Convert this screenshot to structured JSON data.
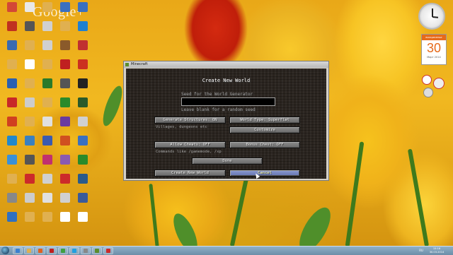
{
  "desktop": {
    "watermark_logo": "Google+",
    "icons_col1": [
      {
        "label": "",
        "icon": "chrome-icon",
        "color": "#d34836"
      },
      {
        "label": "",
        "icon": "app-icon",
        "color": "#c03020"
      },
      {
        "label": "",
        "icon": "app-icon",
        "color": "#3a6ab0"
      },
      {
        "label": "",
        "icon": "folder-icon",
        "color": "#e0b050"
      },
      {
        "label": "",
        "icon": "app-icon",
        "color": "#2a5fb0"
      },
      {
        "label": "",
        "icon": "app-icon",
        "color": "#c82828"
      },
      {
        "label": "",
        "icon": "app-icon",
        "color": "#d04020"
      },
      {
        "label": "",
        "icon": "app-icon",
        "color": "#2288cc"
      },
      {
        "label": "",
        "icon": "app-icon",
        "color": "#3a90d8"
      },
      {
        "label": "",
        "icon": "app-icon",
        "color": "#e0b050"
      },
      {
        "label": "",
        "icon": "app-icon",
        "color": "#888888"
      },
      {
        "label": "",
        "icon": "app-icon",
        "color": "#3070c0"
      }
    ],
    "icons_col2": [
      {
        "label": "",
        "icon": "app-icon",
        "color": "#e8e8e8"
      },
      {
        "label": "",
        "icon": "app-icon",
        "color": "#555555"
      },
      {
        "label": "",
        "icon": "folder-icon",
        "color": "#e0b050"
      },
      {
        "label": "",
        "icon": "app-icon",
        "color": "#ffffff"
      },
      {
        "label": "",
        "icon": "app-icon",
        "color": "#e0b050"
      },
      {
        "label": "",
        "icon": "app-icon",
        "color": "#cccccc"
      },
      {
        "label": "",
        "icon": "app-icon",
        "color": "#e0b050"
      },
      {
        "label": "",
        "icon": "app-icon",
        "color": "#3a80c0"
      },
      {
        "label": "",
        "icon": "app-icon",
        "color": "#555555"
      },
      {
        "label": "",
        "icon": "app-icon",
        "color": "#cc2a2a"
      },
      {
        "label": "",
        "icon": "app-icon",
        "color": "#cccccc"
      },
      {
        "label": "",
        "icon": "app-icon",
        "color": "#e0b050"
      }
    ],
    "icons_col3": [
      {
        "label": "",
        "icon": "folder-icon",
        "color": "#e0b050"
      },
      {
        "label": "",
        "icon": "app-icon",
        "color": "#d0d0d0"
      },
      {
        "label": "",
        "icon": "app-icon",
        "color": "#d0d0d0"
      },
      {
        "label": "",
        "icon": "app-icon",
        "color": "#e0b050"
      },
      {
        "label": "",
        "icon": "app-icon",
        "color": "#2a7a2a"
      },
      {
        "label": "",
        "icon": "app-icon",
        "color": "#e0b050"
      },
      {
        "label": "",
        "icon": "app-icon",
        "color": "#e0e0e0"
      },
      {
        "label": "",
        "icon": "app-icon",
        "color": "#3a5ab0"
      },
      {
        "label": "",
        "icon": "app-icon",
        "color": "#c03070"
      },
      {
        "label": "",
        "icon": "app-icon",
        "color": "#d0d0d0"
      },
      {
        "label": "",
        "icon": "app-icon",
        "color": "#e0e0e0"
      },
      {
        "label": "",
        "icon": "app-icon",
        "color": "#e0b050"
      }
    ],
    "icons_col4": [
      {
        "label": "",
        "icon": "app-icon",
        "color": "#3a70c0"
      },
      {
        "label": "",
        "icon": "folder-icon",
        "color": "#e0b050"
      },
      {
        "label": "",
        "icon": "app-icon",
        "color": "#8a5a2a"
      },
      {
        "label": "",
        "icon": "app-icon",
        "color": "#c02020"
      },
      {
        "label": "",
        "icon": "app-icon",
        "color": "#555555"
      },
      {
        "label": "",
        "icon": "app-icon",
        "color": "#2a8a2a"
      },
      {
        "label": "",
        "icon": "app-icon",
        "color": "#6a3aa0"
      },
      {
        "label": "",
        "icon": "app-icon",
        "color": "#d05020"
      },
      {
        "label": "",
        "icon": "app-icon",
        "color": "#8a5ab0"
      },
      {
        "label": "",
        "icon": "app-icon",
        "color": "#cc2a2a"
      },
      {
        "label": "",
        "icon": "app-icon",
        "color": "#d0d0d0"
      },
      {
        "label": "",
        "icon": "app-icon",
        "color": "#ffffff"
      }
    ],
    "icons_col5": [
      {
        "label": "",
        "icon": "app-icon",
        "color": "#3a70c0"
      },
      {
        "label": "",
        "icon": "app-icon",
        "color": "#2080d0"
      },
      {
        "label": "",
        "icon": "app-icon",
        "color": "#c03030"
      },
      {
        "label": "",
        "icon": "app-icon",
        "color": "#cc3020"
      },
      {
        "label": "",
        "icon": "app-icon",
        "color": "#222222"
      },
      {
        "label": "",
        "icon": "app-icon",
        "color": "#2a5a2a"
      },
      {
        "label": "",
        "icon": "app-icon",
        "color": "#d0d0d0"
      },
      {
        "label": "",
        "icon": "app-icon",
        "color": "#3a70c0"
      },
      {
        "label": "",
        "icon": "app-icon",
        "color": "#2a8a2a"
      },
      {
        "label": "",
        "icon": "app-icon",
        "color": "#2a5a8a"
      },
      {
        "label": "",
        "icon": "app-icon",
        "color": "#3a5a9a"
      },
      {
        "label": "",
        "icon": "app-icon",
        "color": "#ffffff"
      }
    ]
  },
  "minecraft": {
    "window_title": "Minecraft",
    "screen_title": "Create New World",
    "seed_label": "Seed for the World Generator",
    "seed_value": "",
    "seed_hint": "Leave blank for a random seed",
    "generate_structures_btn": "Generate Structures: ON",
    "structures_hint": "Villages, dungeons etc",
    "world_type_btn": "World Type: Superflat",
    "customize_btn": "Customize",
    "allow_cheats_btn": "Allow Cheats: OFF",
    "cheats_hint": "Commands like /gamemode, /xp",
    "bonus_chest_btn": "Bonus Chest: OFF",
    "done_btn": "Done",
    "create_btn": "Create New World",
    "cancel_btn": "Cancel"
  },
  "gadgets": {
    "calendar_weekday": "воскресенье",
    "calendar_day": "30",
    "calendar_month_year": "Март 2014"
  },
  "taskbar": {
    "language": "RU",
    "time": "15:16",
    "date": "30.03.2014"
  },
  "colors": {
    "accent_hover_button": "#6675b0",
    "calendar_orange": "#e66a1a"
  }
}
